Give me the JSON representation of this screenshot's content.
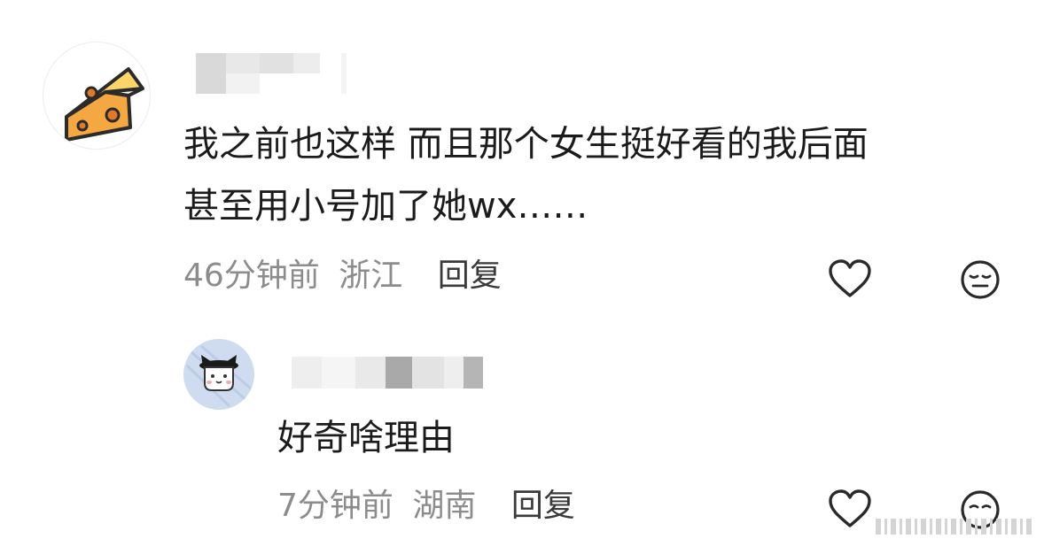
{
  "comments": [
    {
      "avatar_icon": "cheese-icon",
      "text_line1": "我之前也这样 而且那个女生挺好看的我后面",
      "text_line2": "甚至用小号加了她wx……",
      "time": "46分钟前",
      "location": "浙江",
      "reply_label": "回复"
    },
    {
      "avatar_icon": "cat-avatar-icon",
      "text": "好奇啥理由",
      "time": "7分钟前",
      "location": "湖南",
      "reply_label": "回复"
    }
  ],
  "icons": {
    "like": "heart-icon",
    "react": "expressionless-face-icon"
  },
  "colors": {
    "meta_gray": "#8c8c8c",
    "text": "#1b1b1b",
    "cheese": "#f5a742",
    "avatar_bg": "#cfdcf0"
  }
}
